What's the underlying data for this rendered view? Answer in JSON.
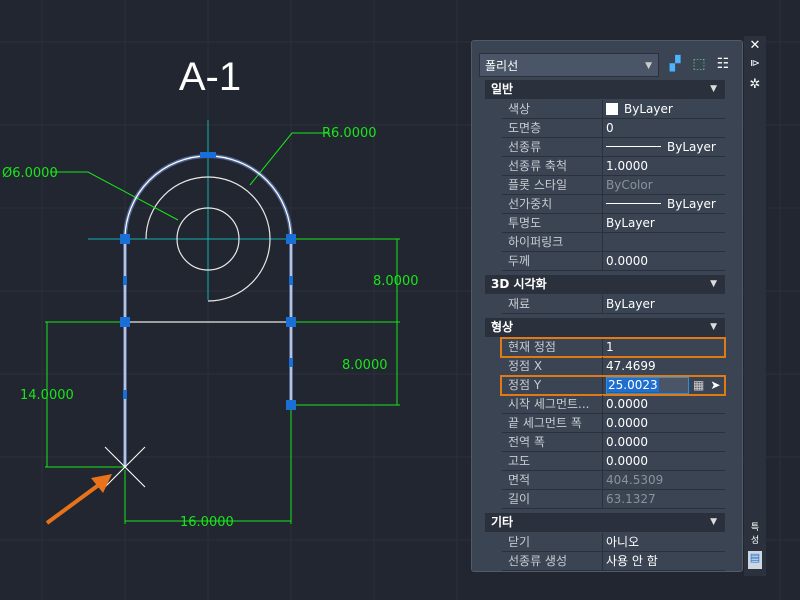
{
  "drawing": {
    "title": "A-1",
    "dims": {
      "radius": "R6.0000",
      "diameter": "Ø6.0000",
      "right_upper": "8.0000",
      "right_lower": "8.0000",
      "left_height": "14.0000",
      "bottom_width": "16.0000"
    },
    "colors": {
      "dimension": "#19e619",
      "polyline": "#7fa8ff",
      "grip": "#1a6fd6",
      "center": "#14b0b0",
      "arrow": "#e8731a"
    }
  },
  "palette": {
    "object_type": "폴리선",
    "toolbar": [
      "quick-select-icon",
      "select-objects-icon",
      "toggle-pickadd-icon"
    ],
    "sections": [
      {
        "title": "일반",
        "rows": [
          {
            "k": "색상",
            "v": "ByLayer"
          },
          {
            "k": "도면층",
            "v": "0"
          },
          {
            "k": "선종류",
            "v": "ByLayer"
          },
          {
            "k": "선종류 축척",
            "v": "1.0000"
          },
          {
            "k": "플롯 스타일",
            "v": "ByColor"
          },
          {
            "k": "선가중치",
            "v": "ByLayer"
          },
          {
            "k": "투명도",
            "v": "ByLayer"
          },
          {
            "k": "하이퍼링크",
            "v": ""
          },
          {
            "k": "두께",
            "v": "0.0000"
          }
        ]
      },
      {
        "title": "3D 시각화",
        "rows": [
          {
            "k": "재료",
            "v": "ByLayer"
          }
        ]
      },
      {
        "title": "형상",
        "rows": [
          {
            "k": "현재 정점",
            "v": "1"
          },
          {
            "k": "정점 X",
            "v": "47.4699"
          },
          {
            "k": "정점 Y",
            "v": "25.0023"
          },
          {
            "k": "시작 세그먼트...",
            "v": "0.0000"
          },
          {
            "k": "끝 세그먼트 폭",
            "v": "0.0000"
          },
          {
            "k": "전역 폭",
            "v": "0.0000"
          },
          {
            "k": "고도",
            "v": "0.0000"
          },
          {
            "k": "면적",
            "v": "404.5309"
          },
          {
            "k": "길이",
            "v": "63.1327"
          }
        ]
      },
      {
        "title": "기타",
        "rows": [
          {
            "k": "닫기",
            "v": "아니오"
          },
          {
            "k": "선종류 생성",
            "v": "사용 안 함"
          }
        ]
      }
    ],
    "side_label": "특성",
    "highlight_color": "#e07a16"
  }
}
